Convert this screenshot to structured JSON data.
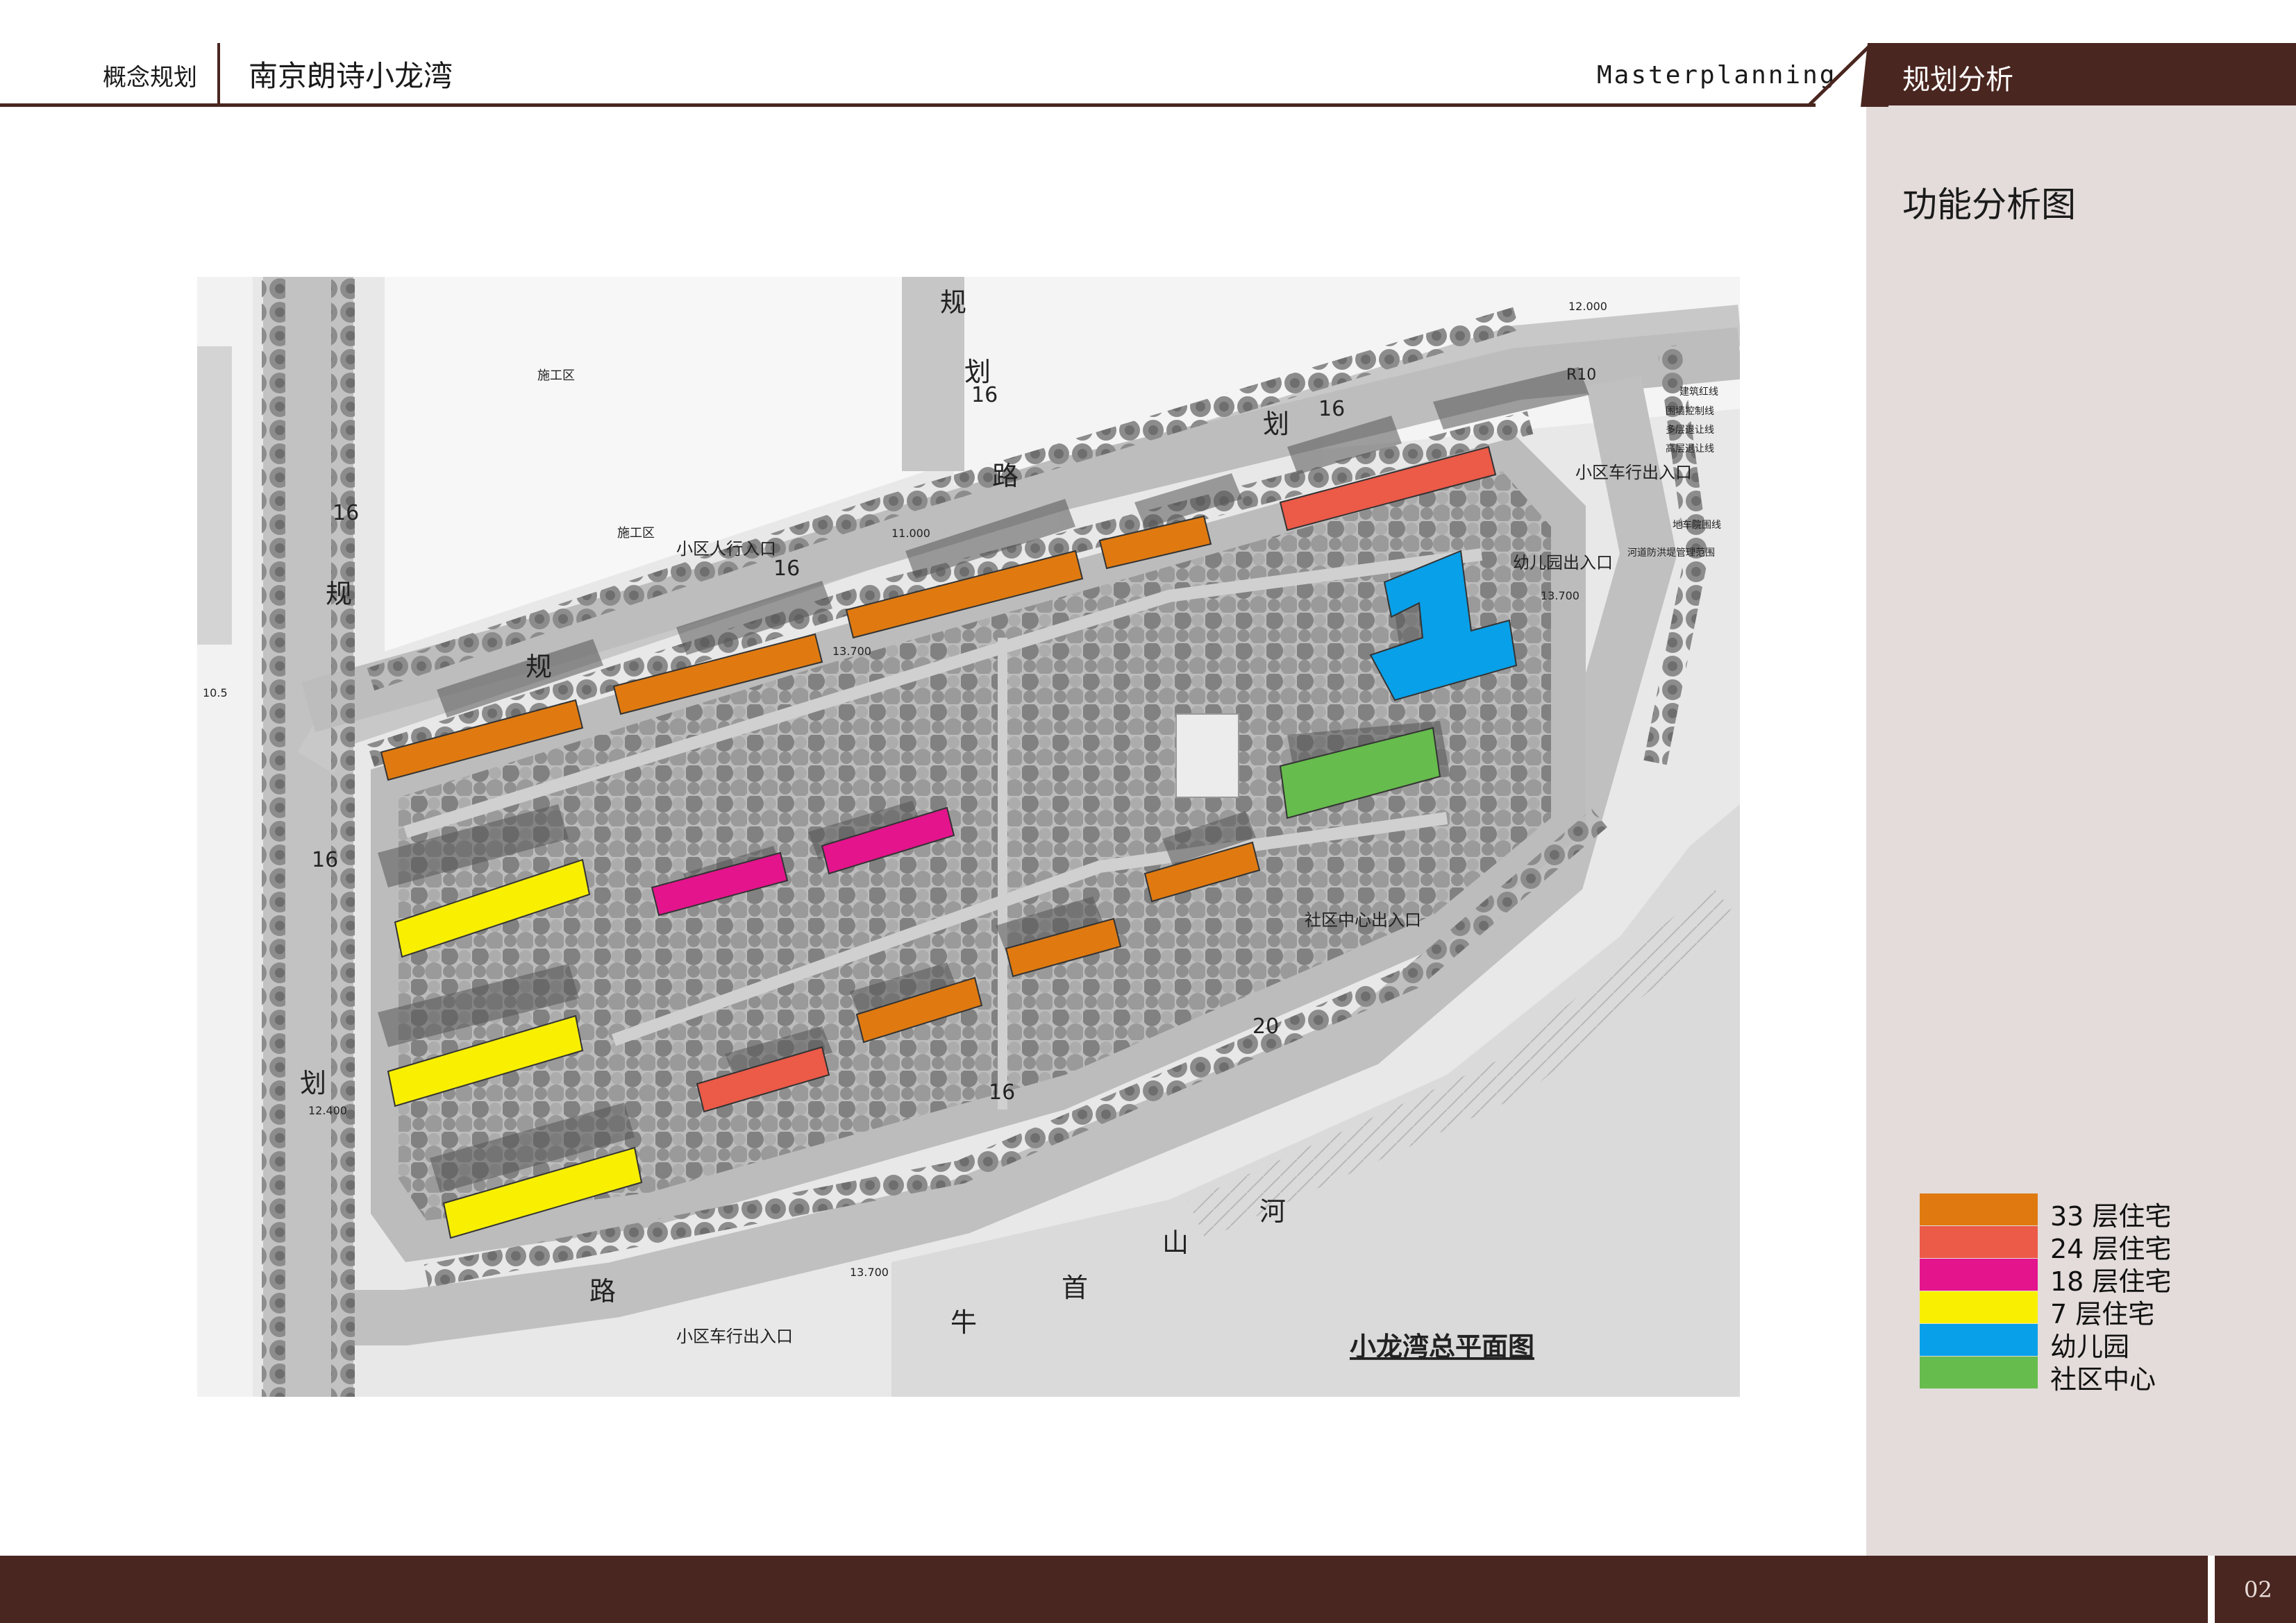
{
  "header": {
    "category": "概念规划",
    "project": "南京朗诗小龙湾",
    "english": "Masterplanning",
    "section": "规划分析"
  },
  "sidebar": {
    "title": "功能分析图"
  },
  "plan": {
    "caption": "小龙湾总平面图",
    "labels": {
      "vehicle_entrance_ne": "小区车行出入口",
      "vehicle_entrance_s": "小区车行出入口",
      "pedestrian_entrance": "小区人行入口",
      "kindergarten_entrance": "幼儿园出入口",
      "community_entrance": "社区中心出入口",
      "construction_1": "施工区",
      "construction_2": "施工区",
      "river_1": "河",
      "river_2": "山",
      "river_3": "首",
      "river_4": "牛",
      "road_1": "规",
      "road_2": "划",
      "road_3": "路",
      "road_w1": "规",
      "road_w2": "划",
      "road_w3": "路",
      "road_n1": "规",
      "road_n2": "划",
      "road_n3": "路",
      "road_n4": "规",
      "width_1": "16",
      "width_2": "16",
      "width_3": "16",
      "width_4": "16",
      "width_5": "20",
      "width_6": "16",
      "width_7": "16",
      "elev_1": "11.000",
      "elev_2": "13.700",
      "elev_3": "13.700",
      "elev_4": "13.700",
      "elev_5": "12.000",
      "elev_6": "12.400",
      "elev_7": "10.5",
      "radius": "R10",
      "legend_line_1": "建筑红线",
      "legend_line_2": "围墙控制线",
      "legend_line_3": "多层退让线",
      "legend_line_4": "高层退让线",
      "legend_line_5": "地车院围线",
      "legend_line_6": "河道防洪堤管理范围"
    }
  },
  "legend": [
    {
      "label": "33 层住宅",
      "color": "#e07a10"
    },
    {
      "label": "24 层住宅",
      "color": "#ec5a48"
    },
    {
      "label": "18 层住宅",
      "color": "#e4148c"
    },
    {
      "label": "7 层住宅",
      "color": "#f8f000"
    },
    {
      "label": "幼儿园",
      "color": "#08a0e8"
    },
    {
      "label": "社区中心",
      "color": "#66bc4c"
    }
  ],
  "footer": {
    "page": "02"
  }
}
